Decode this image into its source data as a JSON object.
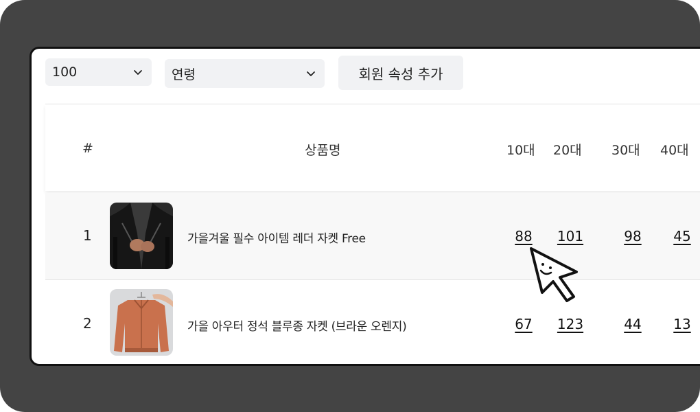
{
  "toolbar": {
    "count_select": "100",
    "group_select": "연령",
    "add_button_label": "회원 속성 추가"
  },
  "table": {
    "headers": {
      "rank": "#",
      "product": "상품명",
      "age_10": "10대",
      "age_20": "20대",
      "age_30": "30대",
      "age_40": "40대"
    },
    "rows": [
      {
        "rank": "1",
        "product": "가을겨울 필수 아이템 레더 자켓 Free",
        "age_10": "88",
        "age_20": "101",
        "age_30": "98",
        "age_40": "45"
      },
      {
        "rank": "2",
        "product": "가을 아우터 정석 블루종 자켓 (브라운 오렌지)",
        "age_10": "67",
        "age_20": "123",
        "age_30": "44",
        "age_40": "13"
      }
    ]
  },
  "icons": {
    "select_arrow": "chevron-down-icon",
    "pointer": "hand-drawn-cursor-icon"
  },
  "colors": {
    "frame": "#444444",
    "panel": "#ffffff",
    "control_bg": "#f1f2f4",
    "row_highlight": "#f8f8f8"
  }
}
